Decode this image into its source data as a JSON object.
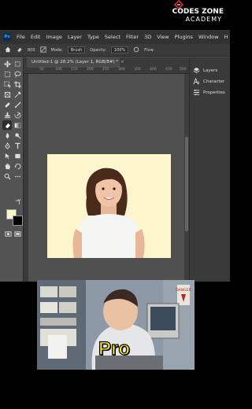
{
  "app": {
    "logo": "Ps",
    "menu": [
      "File",
      "Edit",
      "Image",
      "Layer",
      "Type",
      "Select",
      "Filter",
      "3D",
      "View",
      "Plugins",
      "Window",
      "H"
    ]
  },
  "brand": {
    "line1": "CODES ZONE",
    "line2": "ACADEMY"
  },
  "options": {
    "size": "800",
    "mode_label": "Mode:",
    "mode_value": "Brush",
    "opacity_label": "Opacity:",
    "opacity_value": "100%",
    "flow_label": "Flow:"
  },
  "document": {
    "tab_title": "Untitled-1 @ 28.2% (Layer 1, RGB/8#) *",
    "close": "×"
  },
  "ruler": {
    "ticks": [
      "50",
      "100",
      "150",
      "200",
      "250",
      "300",
      "350",
      "400",
      "450",
      "500"
    ]
  },
  "panels": [
    {
      "label": "Layers",
      "icon": "layers-icon"
    },
    {
      "label": "Character",
      "icon": "character-icon"
    },
    {
      "label": "Properties",
      "icon": "properties-icon"
    }
  ],
  "colors": {
    "foreground": "#fdf5cc",
    "background": "#000000",
    "canvas_bg": "#fdf5cc"
  },
  "meme": {
    "caption": "Pro",
    "sign_text": "DANGER"
  }
}
